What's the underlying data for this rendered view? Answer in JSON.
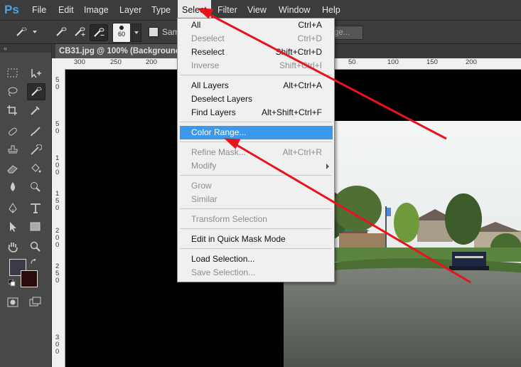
{
  "app": {
    "logo": "Ps"
  },
  "menubar": {
    "items": [
      "File",
      "Edit",
      "Image",
      "Layer",
      "Type",
      "Select",
      "Filter",
      "View",
      "Window",
      "Help"
    ],
    "active": "Select"
  },
  "options": {
    "brush_size": "60",
    "sample_label": "Sam",
    "refine_label": "dge..."
  },
  "tools_header": "«",
  "document": {
    "tab_title": "CB31.jpg @ 100% (Background c",
    "ruler_top": [
      "300",
      "250",
      "200",
      "150",
      "100",
      "50",
      "0",
      "50",
      "100",
      "150",
      "200"
    ],
    "ruler_left": [
      "5",
      "0",
      "5",
      "0",
      "1",
      "0",
      "0",
      "1",
      "5",
      "0",
      "2",
      "0",
      "0",
      "2",
      "5",
      "0",
      "3",
      "0",
      "0"
    ]
  },
  "select_menu": {
    "groups": [
      [
        {
          "label": "All",
          "shortcut": "Ctrl+A",
          "disabled": false
        },
        {
          "label": "Deselect",
          "shortcut": "Ctrl+D",
          "disabled": true
        },
        {
          "label": "Reselect",
          "shortcut": "Shift+Ctrl+D",
          "disabled": false
        },
        {
          "label": "Inverse",
          "shortcut": "Shift+Ctrl+I",
          "disabled": true
        }
      ],
      [
        {
          "label": "All Layers",
          "shortcut": "Alt+Ctrl+A",
          "disabled": false
        },
        {
          "label": "Deselect Layers",
          "shortcut": "",
          "disabled": false
        },
        {
          "label": "Find Layers",
          "shortcut": "Alt+Shift+Ctrl+F",
          "disabled": false
        }
      ],
      [
        {
          "label": "Color Range...",
          "shortcut": "",
          "disabled": false,
          "highlighted": true
        }
      ],
      [
        {
          "label": "Refine Mask...",
          "shortcut": "Alt+Ctrl+R",
          "disabled": true
        },
        {
          "label": "Modify",
          "shortcut": "",
          "disabled": true,
          "submenu": true
        }
      ],
      [
        {
          "label": "Grow",
          "shortcut": "",
          "disabled": true
        },
        {
          "label": "Similar",
          "shortcut": "",
          "disabled": true
        }
      ],
      [
        {
          "label": "Transform Selection",
          "shortcut": "",
          "disabled": true
        }
      ],
      [
        {
          "label": "Edit in Quick Mask Mode",
          "shortcut": "",
          "disabled": false
        }
      ],
      [
        {
          "label": "Load Selection...",
          "shortcut": "",
          "disabled": false
        },
        {
          "label": "Save Selection...",
          "shortcut": "",
          "disabled": true
        }
      ]
    ]
  },
  "colors": {
    "highlight": "#3c98e8",
    "annotation_arrow": "#e8141c",
    "foreground_swatch": "#3a3a48",
    "background_swatch": "#2a0c0c"
  }
}
